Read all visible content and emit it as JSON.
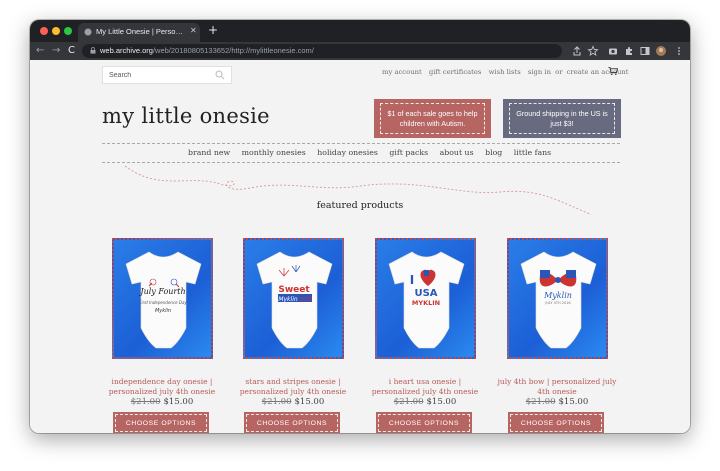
{
  "browser": {
    "tab_title": "My Little Onesie | Personalized",
    "tab_close": "✕",
    "new_tab": "+",
    "url_host": "web.archive.org",
    "url_path": "/web/20180805133652/http://mylittleonesie.com/",
    "nav_back": "←",
    "nav_forward": "→",
    "nav_reload": "C"
  },
  "header": {
    "search_placeholder": "Search",
    "links": [
      "my account",
      "gift certificates",
      "wish lists",
      "sign in",
      "or",
      "create an account"
    ],
    "title": "my little onesie",
    "promo_left": "$1 of each sale goes to help children with Autism.",
    "promo_right": "Ground shipping in the US is just $3!"
  },
  "nav": {
    "items": [
      "brand new",
      "monthly onesies",
      "holiday onesies",
      "gift packs",
      "about us",
      "blog",
      "little fans"
    ]
  },
  "featured": {
    "heading": "featured products",
    "products": [
      {
        "name": "independence day onesie | personalized july 4th onesie",
        "old_price": "$21.00",
        "price": "$15.00",
        "button": "CHOOSE OPTIONS"
      },
      {
        "name": "stars and stripes onesie | personalized july 4th onesie",
        "old_price": "$21.00",
        "price": "$15.00",
        "button": "CHOOSE OPTIONS"
      },
      {
        "name": "i heart usa onesie | personalized july 4th onesie",
        "old_price": "$21.00",
        "price": "$15.00",
        "button": "CHOOSE OPTIONS"
      },
      {
        "name": "july 4th bow | personalized july 4th onesie",
        "old_price": "$21.00",
        "price": "$15.00",
        "button": "CHOOSE OPTIONS"
      }
    ]
  },
  "colors": {
    "accent_red": "#b66563",
    "accent_slate": "#686a7f",
    "product_bg": "#2a7de8"
  }
}
